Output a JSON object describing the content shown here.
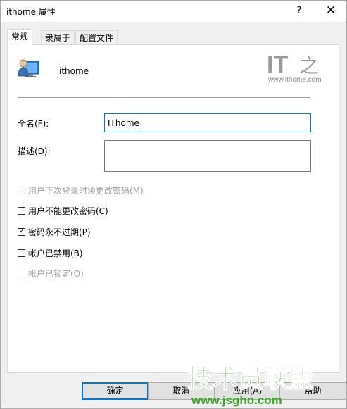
{
  "window": {
    "title": "ithome 属性",
    "help": "?",
    "close": "✕"
  },
  "tabs": [
    {
      "label": "常规",
      "active": true
    },
    {
      "label": "隶属于",
      "active": false
    },
    {
      "label": "配置文件",
      "active": false
    }
  ],
  "general": {
    "username": "ithome",
    "fullname_label": "全名(F):",
    "fullname_value": "IThome",
    "description_label": "描述(D):",
    "description_value": ""
  },
  "checkboxes": [
    {
      "label": "用户下次登录时须更改密码(M)",
      "checked": false,
      "disabled": true
    },
    {
      "label": "用户不能更改密码(C)",
      "checked": false,
      "disabled": false
    },
    {
      "label": "密码永不过期(P)",
      "checked": true,
      "disabled": false
    },
    {
      "label": "帐户已禁用(B)",
      "checked": false,
      "disabled": false
    },
    {
      "label": "帐户已锁定(O)",
      "checked": false,
      "disabled": true
    }
  ],
  "buttons": {
    "ok": "确定",
    "cancel": "取消",
    "apply": "应用(A)",
    "help": "帮助"
  },
  "watermark": {
    "logo": "IT之家",
    "url": "www.ithome.com",
    "site": "技术员联盟",
    "site_url": "www.jsgho.com"
  }
}
